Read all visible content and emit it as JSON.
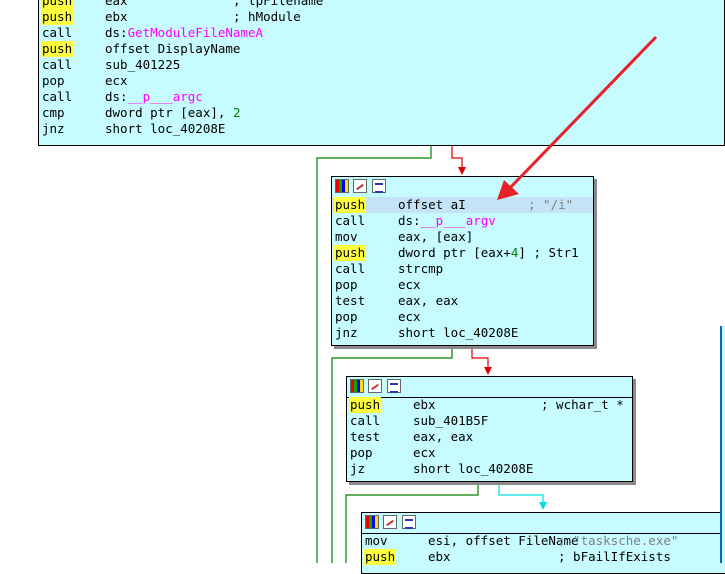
{
  "block_top": {
    "lines": [
      {
        "mn": "push",
        "ops": "eax",
        "cmt": "; lpFilename"
      },
      {
        "mn": "push",
        "ops": "ebx",
        "cmt": "; hModule"
      },
      {
        "mn": "call",
        "pre": "ds:",
        "fn": "GetModuleFileNameA"
      },
      {
        "mn": "push",
        "ops": "offset DisplayName"
      },
      {
        "mn": "call",
        "ops": "sub_401225"
      },
      {
        "mn": "pop",
        "ops": "ecx"
      },
      {
        "mn": "call",
        "pre": "ds:",
        "fn": "__p___argc"
      },
      {
        "mn": "cmp",
        "ops": "dword ptr [eax], ",
        "num": "2"
      },
      {
        "mn": "jnz",
        "ops": "short loc_40208E"
      }
    ]
  },
  "block_argv": {
    "lines": [
      {
        "mn": "push",
        "ops": "offset aI",
        "cmt": "; \"/i\""
      },
      {
        "mn": "call",
        "pre": "ds:",
        "fn": "__p___argv"
      },
      {
        "mn": "mov",
        "ops": "eax, [eax]"
      },
      {
        "mn": "push",
        "ops": "dword ptr [eax+",
        "num": "4",
        "post": "] ; Str1"
      },
      {
        "mn": "call",
        "ops": "strcmp"
      },
      {
        "mn": "pop",
        "ops": "ecx"
      },
      {
        "mn": "test",
        "ops": "eax, eax"
      },
      {
        "mn": "pop",
        "ops": "ecx"
      },
      {
        "mn": "jnz",
        "ops": "short loc_40208E"
      }
    ]
  },
  "block_sub": {
    "lines": [
      {
        "mn": "push",
        "ops": "ebx",
        "cmt": "; wchar_t *"
      },
      {
        "mn": "call",
        "ops": "sub_401B5F"
      },
      {
        "mn": "test",
        "ops": "eax, eax"
      },
      {
        "mn": "pop",
        "ops": "ecx"
      },
      {
        "mn": "jz",
        "ops": "short loc_40208E"
      }
    ]
  },
  "block_copy": {
    "lines": [
      {
        "mn": "mov",
        "ops": "esi, offset FileName",
        "cmt": "; \"tasksche.exe\""
      },
      {
        "mn": "push",
        "ops": "ebx",
        "cmt": "; bFailIfExists"
      }
    ]
  },
  "icons": [
    "colors-icon",
    "graph-icon",
    "list-icon"
  ],
  "colors": {
    "node_bg": "#c6fbff",
    "push_hl": "#ffff40",
    "name": "#ff00ff",
    "imm": "#008000",
    "string": "#808080",
    "edge_false": "#e00000",
    "edge_true": "#008000",
    "edge_uncond": "#00e0e0",
    "arrow": "#e8202a"
  }
}
